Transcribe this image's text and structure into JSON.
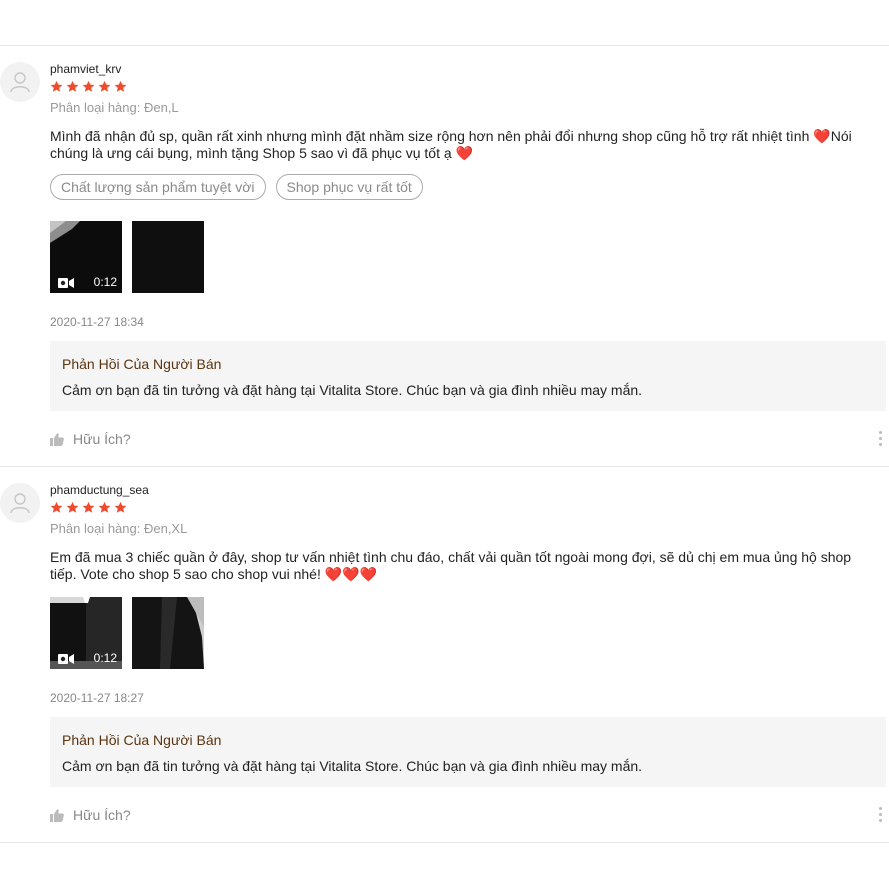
{
  "reviews": [
    {
      "username": "phamviet_krv",
      "rating": 5,
      "variation": "Phân loại hàng: Đen,L",
      "content_text": "Mình đã nhận đủ sp, quần rất xinh nhưng mình đặt nhầm size rộng hơn nên phải đổi nhưng shop cũng hỗ trợ rất nhiệt tình ",
      "content_emoji": "❤️",
      "content_text_2": "Nói chúng là ưng cái bụng, mình tặng Shop 5 sao vì đã phục vụ tốt ạ ",
      "content_emoji_2": "❤️",
      "tags": [
        "Chất lượng sản phẩm tuyệt vời",
        "Shop phục vụ rất tốt"
      ],
      "video_duration": "0:12",
      "date": "2020-11-27 18:34",
      "reply_title": "Phản Hồi Của Người Bán",
      "reply_text": "Cảm ơn bạn đã tin tưởng và đặt hàng tại Vitalita Store. Chúc bạn và gia đình nhiều may mắn.",
      "helpful_label": "Hữu Ích?"
    },
    {
      "username": "phamductung_sea",
      "rating": 5,
      "variation": "Phân loại hàng: Đen,XL",
      "content_text": "Em đã mua 3 chiếc quần ở đây, shop tư vấn nhiệt tình chu đáo, chất vải quần tốt ngoài mong đợi, sẽ dủ chị em mua ủng hộ shop tiếp. Vote cho shop 5 sao cho shop vui nhé! ",
      "content_emoji": "❤️❤️❤️",
      "video_duration": "0:12",
      "date": "2020-11-27 18:27",
      "reply_title": "Phản Hồi Của Người Bán",
      "reply_text": "Cảm ơn bạn đã tin tưởng và đặt hàng tại Vitalita Store. Chúc bạn và gia đình nhiều may mắn.",
      "helpful_label": "Hữu Ích?"
    }
  ],
  "colors": {
    "star": "#ee4d2d",
    "heart": "#e2433a",
    "reply_title": "#5a3410",
    "reply_bg": "#f5f5f5",
    "muted": "#888888"
  },
  "icons": [
    "avatar-placeholder-icon",
    "star-icon",
    "video-camera-icon",
    "thumbs-up-icon",
    "more-options-icon"
  ]
}
